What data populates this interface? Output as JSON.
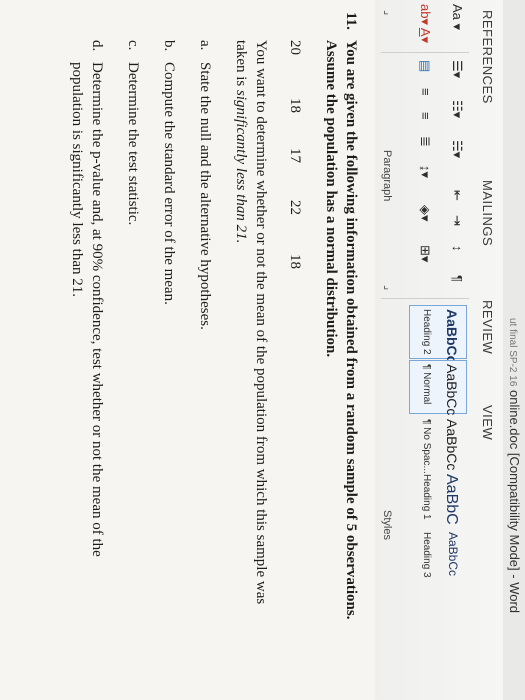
{
  "window": {
    "title": "online.doc [Compatibility Mode] - Word",
    "title_prefix": "ut final SP-2 16"
  },
  "tabs": [
    "REFERENCES",
    "MAILINGS",
    "REVIEW",
    "VIEW"
  ],
  "font_group": {
    "change_case": "Aa"
  },
  "paragraph_group": {
    "label": "Paragraph",
    "pilcrow": "¶"
  },
  "styles_group": {
    "label": "Styles",
    "items": [
      {
        "sample": "AaBbCcI",
        "name": "Heading 2"
      },
      {
        "sample": "AaBbCc",
        "name": "¶ Normal"
      },
      {
        "sample": "AaBbCc",
        "name": "¶ No Spac..."
      },
      {
        "sample": "AaBbC",
        "name": "Heading 1"
      },
      {
        "sample": "AaBbCc",
        "name": "Heading 3"
      }
    ]
  },
  "question": {
    "number": "11.",
    "intro_line1": "You are given the following information obtained from a random sample of 5 observations.",
    "intro_line2": "Assume the population has a normal distribution.",
    "observations": [
      "20",
      "18",
      "17",
      "22",
      "18"
    ],
    "task_line1": "You want to determine whether or not the mean of the population from which this sample was",
    "task_line2_plain": "taken is ",
    "task_line2_italic": "significantly less than 21.",
    "parts": [
      {
        "letter": "a.",
        "text": "State the null and the alternative hypotheses."
      },
      {
        "letter": "b.",
        "text": "Compute the standard error of the mean."
      },
      {
        "letter": "c.",
        "text": "Determine the test statistic."
      },
      {
        "letter": "d.",
        "text": "Determine the p-value and, at 90% confidence, test whether or not the mean of the",
        "text2": "population is significantly less than 21."
      }
    ]
  },
  "colors": {
    "ribbon_bg": "#f7f7f6",
    "selected_style_border": "#7aa6d8",
    "accent_red": "#c0392b"
  }
}
